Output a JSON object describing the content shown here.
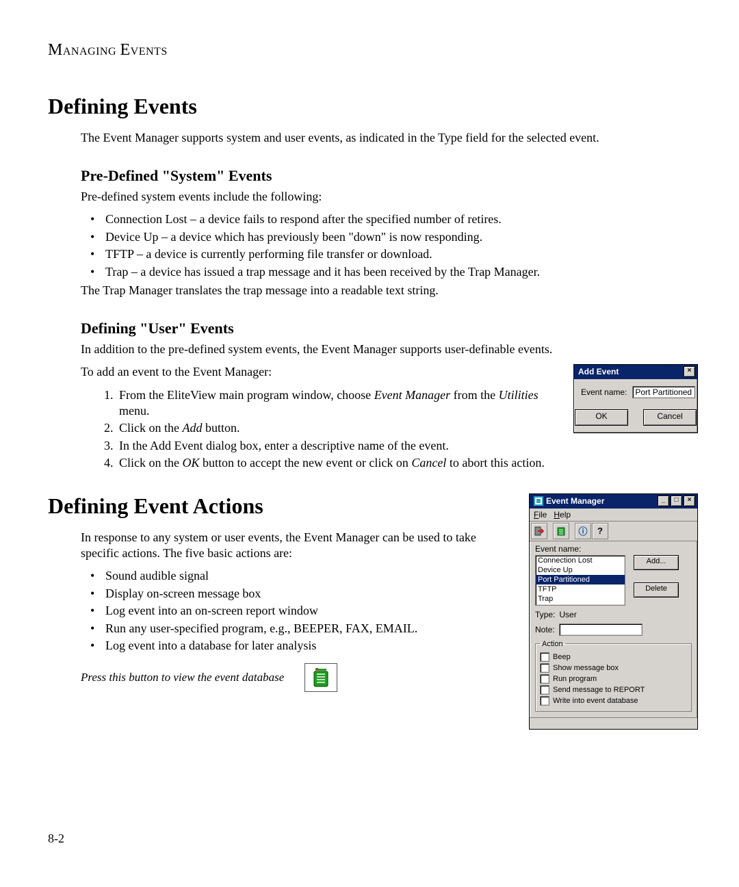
{
  "header": {
    "chapter_label": "Managing Events"
  },
  "sec1": {
    "title": "Defining Events",
    "intro": "The Event Manager supports system and user events, as indicated in the Type field for the selected event.",
    "sub1_title": "Pre-Defined \"System\" Events",
    "sub1_intro": "Pre-defined system events include the following:",
    "bullets": [
      "Connection Lost – a device fails to respond after the specified number of retires.",
      "Device Up – a device which has previously been \"down\" is now responding.",
      "TFTP – a device is currently performing file transfer or download.",
      "Trap – a device has issued a trap message and it has been received by the Trap Manager."
    ],
    "sub1_outro": "The Trap Manager translates the trap message into a readable text string.",
    "sub2_title": "Defining \"User\" Events",
    "sub2_intro": "In addition to the pre-defined system events, the Event Manager supports user-definable events.",
    "sub2_lead": "To add an event to the Event Manager:",
    "steps": {
      "s1_a": "From the EliteView main program window, choose ",
      "s1_em1": "Event Manager",
      "s1_b": " from the ",
      "s1_em2": "Utilities",
      "s1_c": " menu.",
      "s2_a": "Click on the ",
      "s2_em": "Add",
      "s2_b": " button.",
      "s3": "In the Add Event dialog box, enter a descriptive name of the event.",
      "s4_a": "Click on the ",
      "s4_em1": "OK",
      "s4_b": " button to accept the new event or click on ",
      "s4_em2": "Cancel",
      "s4_c": " to abort this action."
    }
  },
  "dialog": {
    "title": "Add Event",
    "field_label": "Event name:",
    "field_value": "Port Partitioned",
    "ok": "OK",
    "cancel": "Cancel"
  },
  "sec2": {
    "title": "Defining Event Actions",
    "intro": "In response to any system or user events, the Event Manager can be used to take specific actions. The five basic actions are:",
    "bullets": [
      "Sound audible signal",
      "Display on-screen message box",
      "Log event into an on-screen report window",
      "Run any user-specified program, e.g., BEEPER, FAX, EMAIL.",
      "Log event into a database for later analysis"
    ],
    "db_hint": "Press this button to view the event database"
  },
  "em_window": {
    "title": "Event Manager",
    "menu": {
      "file": "File",
      "help": "Help"
    },
    "event_name_label": "Event name:",
    "list": [
      "Connection Lost",
      "Device Up",
      "Port Partitioned",
      "TFTP",
      "Trap"
    ],
    "selected_index": 2,
    "add_btn": "Add...",
    "delete_btn": "Delete",
    "type_label": "Type:",
    "type_value": "User",
    "note_label": "Note:",
    "note_value": "",
    "action_legend": "Action",
    "actions": [
      "Beep",
      "Show message box",
      "Run program",
      "Send message to REPORT",
      "Write into event database"
    ]
  },
  "page_number": "8-2"
}
